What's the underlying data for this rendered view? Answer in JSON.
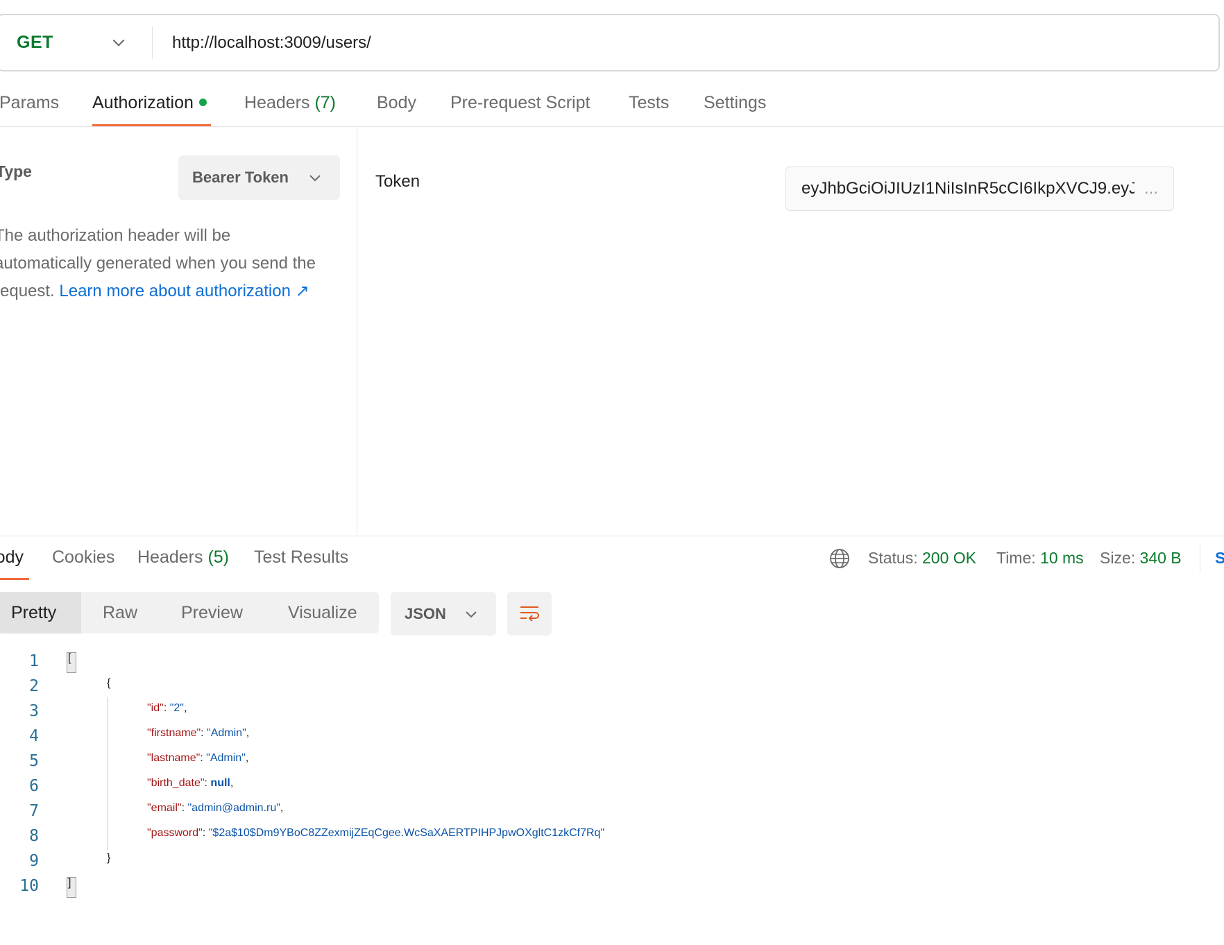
{
  "request": {
    "method": "GET",
    "url": "http://localhost:3009/users/"
  },
  "request_tabs": {
    "params": "Params",
    "authorization": "Authorization",
    "headers": "Headers",
    "headers_count": "(7)",
    "body": "Body",
    "pre_request_script": "Pre-request Script",
    "tests": "Tests",
    "settings": "Settings"
  },
  "auth": {
    "type_label": "Type",
    "type_value": "Bearer Token",
    "description_line1": "The authorization header will be",
    "description_line2": "automatically generated when you send the",
    "description_line3": "request.",
    "learn_more": "Learn more about authorization ↗",
    "token_label": "Token",
    "token_value": "eyJhbGciOiJIUzI1NiIsInR5cCI6IkpXVCJ9.eyJ",
    "token_ellipsis": "..."
  },
  "response_tabs": {
    "body": "Body",
    "cookies": "Cookies",
    "headers": "Headers",
    "headers_count": "(5)",
    "test_results": "Test Results"
  },
  "response_stats": {
    "status_label": "Status:",
    "status_value": "200 OK",
    "time_label": "Time:",
    "time_value": "10 ms",
    "size_label": "Size:",
    "size_value": "340 B",
    "save_button": "S"
  },
  "view_modes": {
    "pretty": "Pretty",
    "raw": "Raw",
    "preview": "Preview",
    "visualize": "Visualize"
  },
  "format": "JSON",
  "colors": {
    "accent": "#f26b3a",
    "success": "#0c7a2e",
    "link": "#0d6fd6"
  },
  "code": {
    "line_numbers": [
      "1",
      "2",
      "3",
      "4",
      "5",
      "6",
      "7",
      "8",
      "9",
      "10"
    ],
    "open_array": "[",
    "open_obj": "{",
    "close_obj": "}",
    "close_array": "]",
    "fields": [
      {
        "key": "\"id\"",
        "value": "\"2\"",
        "type": "string",
        "trail": ","
      },
      {
        "key": "\"firstname\"",
        "value": "\"Admin\"",
        "type": "string",
        "trail": ","
      },
      {
        "key": "\"lastname\"",
        "value": "\"Admin\"",
        "type": "string",
        "trail": ","
      },
      {
        "key": "\"birth_date\"",
        "value": "null",
        "type": "null",
        "trail": ","
      },
      {
        "key": "\"email\"",
        "value": "\"admin@admin.ru\"",
        "type": "string",
        "trail": ","
      },
      {
        "key": "\"password\"",
        "value": "\"$2a$10$Dm9YBoC8ZZexmijZEqCgee.WcSaXAERTPIHPJpwOXgltC1zkCf7Rq\"",
        "type": "string",
        "trail": ""
      }
    ]
  }
}
